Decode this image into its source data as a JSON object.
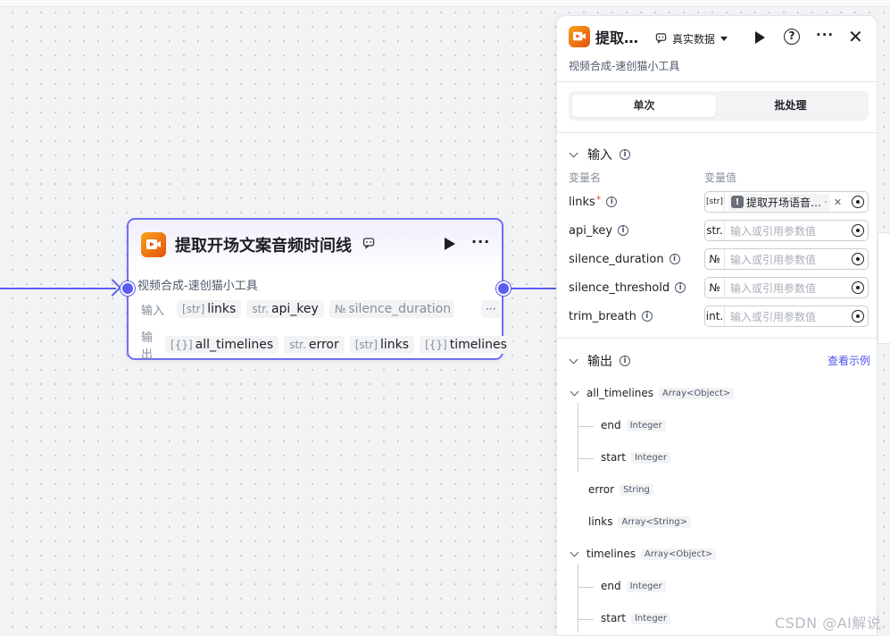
{
  "canvas": {
    "node": {
      "title": "提取开场文案音频时间线",
      "title_icon": "chat-bubble-icon",
      "description": "视频合成-速创猫小工具",
      "input_label": "输入",
      "output_label": "输出",
      "inputs": [
        {
          "type": "[str]",
          "name": "links"
        },
        {
          "type": "str.",
          "name": "api_key"
        },
        {
          "type": "№",
          "name": "silence_duration"
        }
      ],
      "more_inputs": "···",
      "outputs": [
        {
          "type": "[{}]",
          "name": "all_timelines"
        },
        {
          "type": "str.",
          "name": "error"
        },
        {
          "type": "[str]",
          "name": "links"
        },
        {
          "type": "[{}]",
          "name": "timelines"
        }
      ]
    }
  },
  "panel": {
    "title": "提取…",
    "env_label": "真实数据",
    "subtitle": "视频合成-速创猫小工具",
    "tabs": [
      "单次",
      "批处理"
    ],
    "input_section": "输入",
    "col_name": "变量名",
    "col_value": "变量值",
    "fields": [
      {
        "name": "links",
        "required": "*",
        "type": "[str]",
        "value": "提取开场语音…",
        "placeholder": ""
      },
      {
        "name": "api_key",
        "required": "",
        "type": "str.",
        "value": "",
        "placeholder": "输入或引用参数值"
      },
      {
        "name": "silence_duration",
        "required": "",
        "type": "№",
        "value": "",
        "placeholder": "输入或引用参数值"
      },
      {
        "name": "silence_threshold",
        "required": "",
        "type": "№",
        "value": "",
        "placeholder": "输入或引用参数值"
      },
      {
        "name": "trim_breath",
        "required": "",
        "type": "int.",
        "value": "",
        "placeholder": "输入或引用参数值"
      }
    ],
    "output_section": "输出",
    "example_link": "查看示例",
    "outputs": [
      {
        "name": "all_timelines",
        "type": "Array<Object>"
      },
      {
        "name": "end",
        "type": "Integer"
      },
      {
        "name": "start",
        "type": "Integer"
      },
      {
        "name": "error",
        "type": "String"
      },
      {
        "name": "links",
        "type": "Array<String>"
      },
      {
        "name": "timelines",
        "type": "Array<Object>"
      },
      {
        "name": "end",
        "type": "Integer"
      },
      {
        "name": "start",
        "type": "Integer"
      }
    ]
  },
  "watermark": "CSDN @AI解说",
  "colors": {
    "accent": "#5b5cf0",
    "link": "#4d53e8",
    "icon_orange": "#f07a14"
  }
}
